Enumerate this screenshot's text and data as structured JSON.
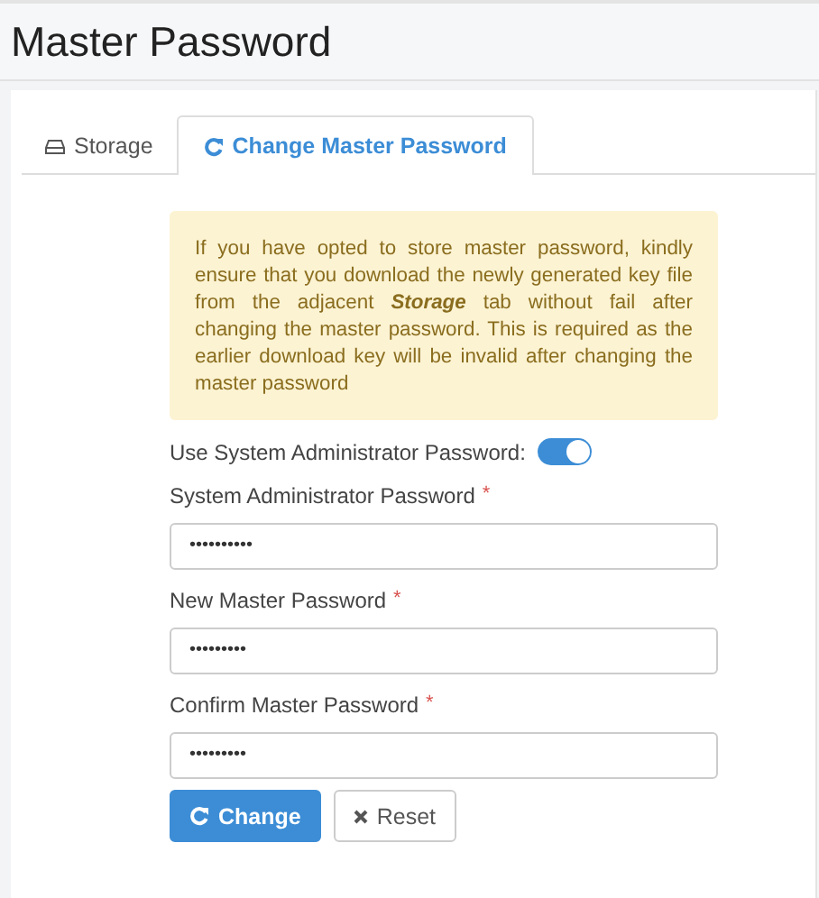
{
  "page_title": "Master Password",
  "tabs": [
    {
      "label": "Storage",
      "selected": false
    },
    {
      "label": "Change Master Password",
      "selected": true
    }
  ],
  "alert": "If you have opted to store master password, kindly ensure that you download the newly generated key file from the adjacent **Storage** tab without fail after changing the master password. This is required as the earlier download key will be invalid after changing the master password",
  "toggle": {
    "label": "Use System Administrator Password:",
    "on": true
  },
  "fields": [
    {
      "label": "System Administrator Password",
      "required_mark": "*",
      "value": "••••••••••"
    },
    {
      "label": "New Master Password",
      "required_mark": "*",
      "value": "•••••••••"
    },
    {
      "label": "Confirm Master Password",
      "required_mark": "*",
      "value": "•••••••••"
    }
  ],
  "buttons": [
    {
      "label": "Change",
      "kind": "primary"
    },
    {
      "label": "Reset",
      "kind": "secondary"
    }
  ]
}
